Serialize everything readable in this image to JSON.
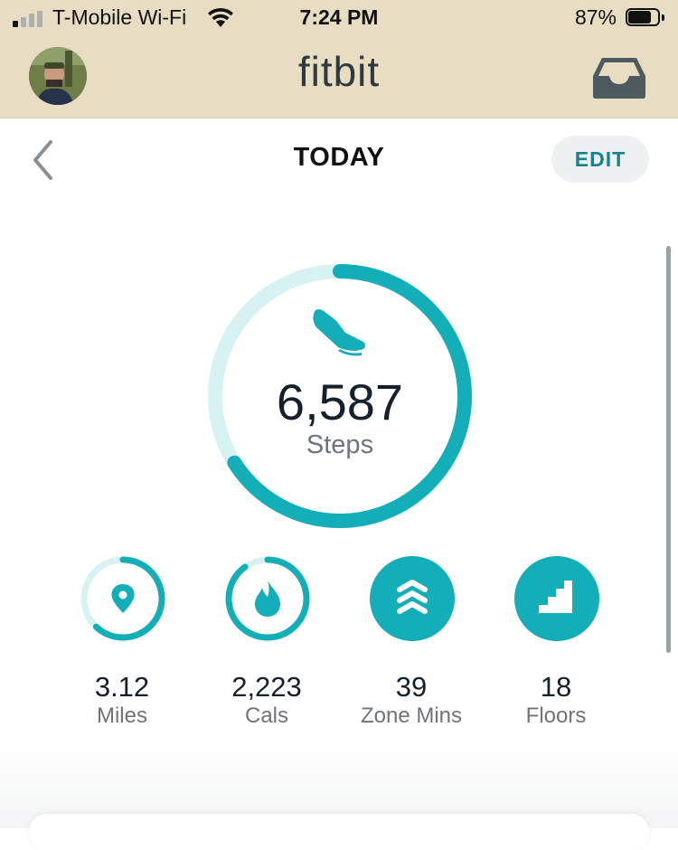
{
  "status_bar": {
    "carrier": "T-Mobile Wi-Fi",
    "time": "7:24 PM",
    "battery_percent": "87%",
    "battery_level": 0.87,
    "signal_bars": 1
  },
  "header": {
    "logo": "fitbit",
    "avatar_icon": "user-avatar",
    "inbox_icon": "inbox-icon"
  },
  "nav": {
    "title": "TODAY",
    "edit_label": "EDIT",
    "back_icon": "chevron-left-icon"
  },
  "steps": {
    "value": "6,587",
    "label": "Steps",
    "progress": 0.66,
    "icon": "shoe-icon"
  },
  "stats": [
    {
      "value": "3.12",
      "label": "Miles",
      "icon": "location-pin-icon",
      "progress": 0.62,
      "filled": false
    },
    {
      "value": "2,223",
      "label": "Cals",
      "icon": "flame-icon",
      "progress": 0.9,
      "filled": false
    },
    {
      "value": "39",
      "label": "Zone Mins",
      "icon": "chevrons-up-icon",
      "progress": 1,
      "filled": true
    },
    {
      "value": "18",
      "label": "Floors",
      "icon": "stairs-icon",
      "progress": 1,
      "filled": true
    }
  ],
  "colors": {
    "accent": "#13aeb7",
    "accent_light": "#d7f2f3",
    "header_bg": "#e8dcc3"
  }
}
